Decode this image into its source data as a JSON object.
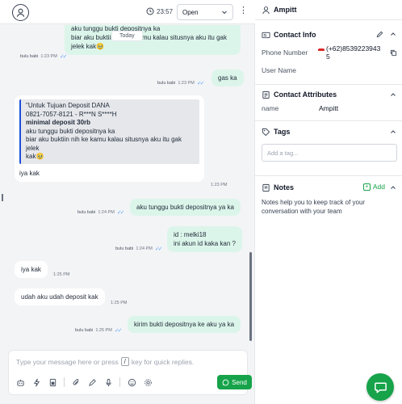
{
  "header": {
    "timer": "23:57",
    "status": "Open"
  },
  "conversation": {
    "date_separator": "Today",
    "messages": [
      {
        "id": "m1",
        "direction": "out",
        "lines": [
          "aku tunggu bukti depositnya ka",
          "biar aku buktiin nih ke kamu kalau situsnya aku itu gak",
          "jelek kak🥹"
        ],
        "sender": "bulu babi",
        "time": "1:23 PM"
      },
      {
        "id": "m2",
        "direction": "out",
        "lines": [
          "gas ka"
        ],
        "sender": "bulu babi",
        "time": "1:23 PM"
      },
      {
        "id": "m3",
        "direction": "in",
        "quote": {
          "line1": "\"Untuk Tujuan Deposit DANA",
          "line2": "0821-7057-8121 - R***N S****H",
          "line3": "minimal deposit 30rb",
          "line4": "aku tunggu bukti depositnya ka",
          "line5": "biar aku buktiin nih ke kamu kalau situsnya aku itu gak jelek",
          "line6": "kak🥹"
        },
        "text": "iya kak",
        "time": "1:23 PM"
      },
      {
        "id": "m4",
        "direction": "out",
        "lines": [
          "aku tunggu bukti depositnya ya ka"
        ],
        "sender": "bulu babi",
        "time": "1:24 PM"
      },
      {
        "id": "m5",
        "direction": "out",
        "lines": [
          "id : melki18",
          "ini akun id kaka kan ?"
        ],
        "sender": "bulu babi",
        "time": "1:24 PM"
      },
      {
        "id": "m6",
        "direction": "in",
        "lines": [
          "iya kak"
        ],
        "time": "1:25 PM"
      },
      {
        "id": "m7",
        "direction": "in",
        "lines": [
          "udah aku udah deposit kak"
        ],
        "time": "1:25 PM"
      },
      {
        "id": "m8",
        "direction": "out",
        "lines": [
          "kirim bukti depositnya ke aku ya ka"
        ],
        "sender": "bulu babi",
        "time": "1:25 PM"
      }
    ]
  },
  "composer": {
    "placeholder_before": "Type your message here or press",
    "shortcut_key": "/",
    "placeholder_after": "key for quick replies.",
    "send_label": "Send"
  },
  "contact": {
    "name": "Ampitt",
    "info_title": "Contact Info",
    "phone_label": "Phone Number",
    "phone_value_line1": "(+62)8539223943",
    "phone_value_line2": "5",
    "username_label": "User Name",
    "attributes_title": "Contact Attributes",
    "attr_name_label": "name",
    "attr_name_value": "Ampitt",
    "tags_title": "Tags",
    "tag_placeholder": "Add a tag...",
    "notes_title": "Notes",
    "notes_add": "Add",
    "notes_help": "Notes help you to keep track of your conversation with your team"
  },
  "colors": {
    "accent": "#16a34a",
    "outgoing_bubble": "#dcf5ea",
    "background": "#f3f4f6",
    "read_ticks": "#60a5fa"
  }
}
